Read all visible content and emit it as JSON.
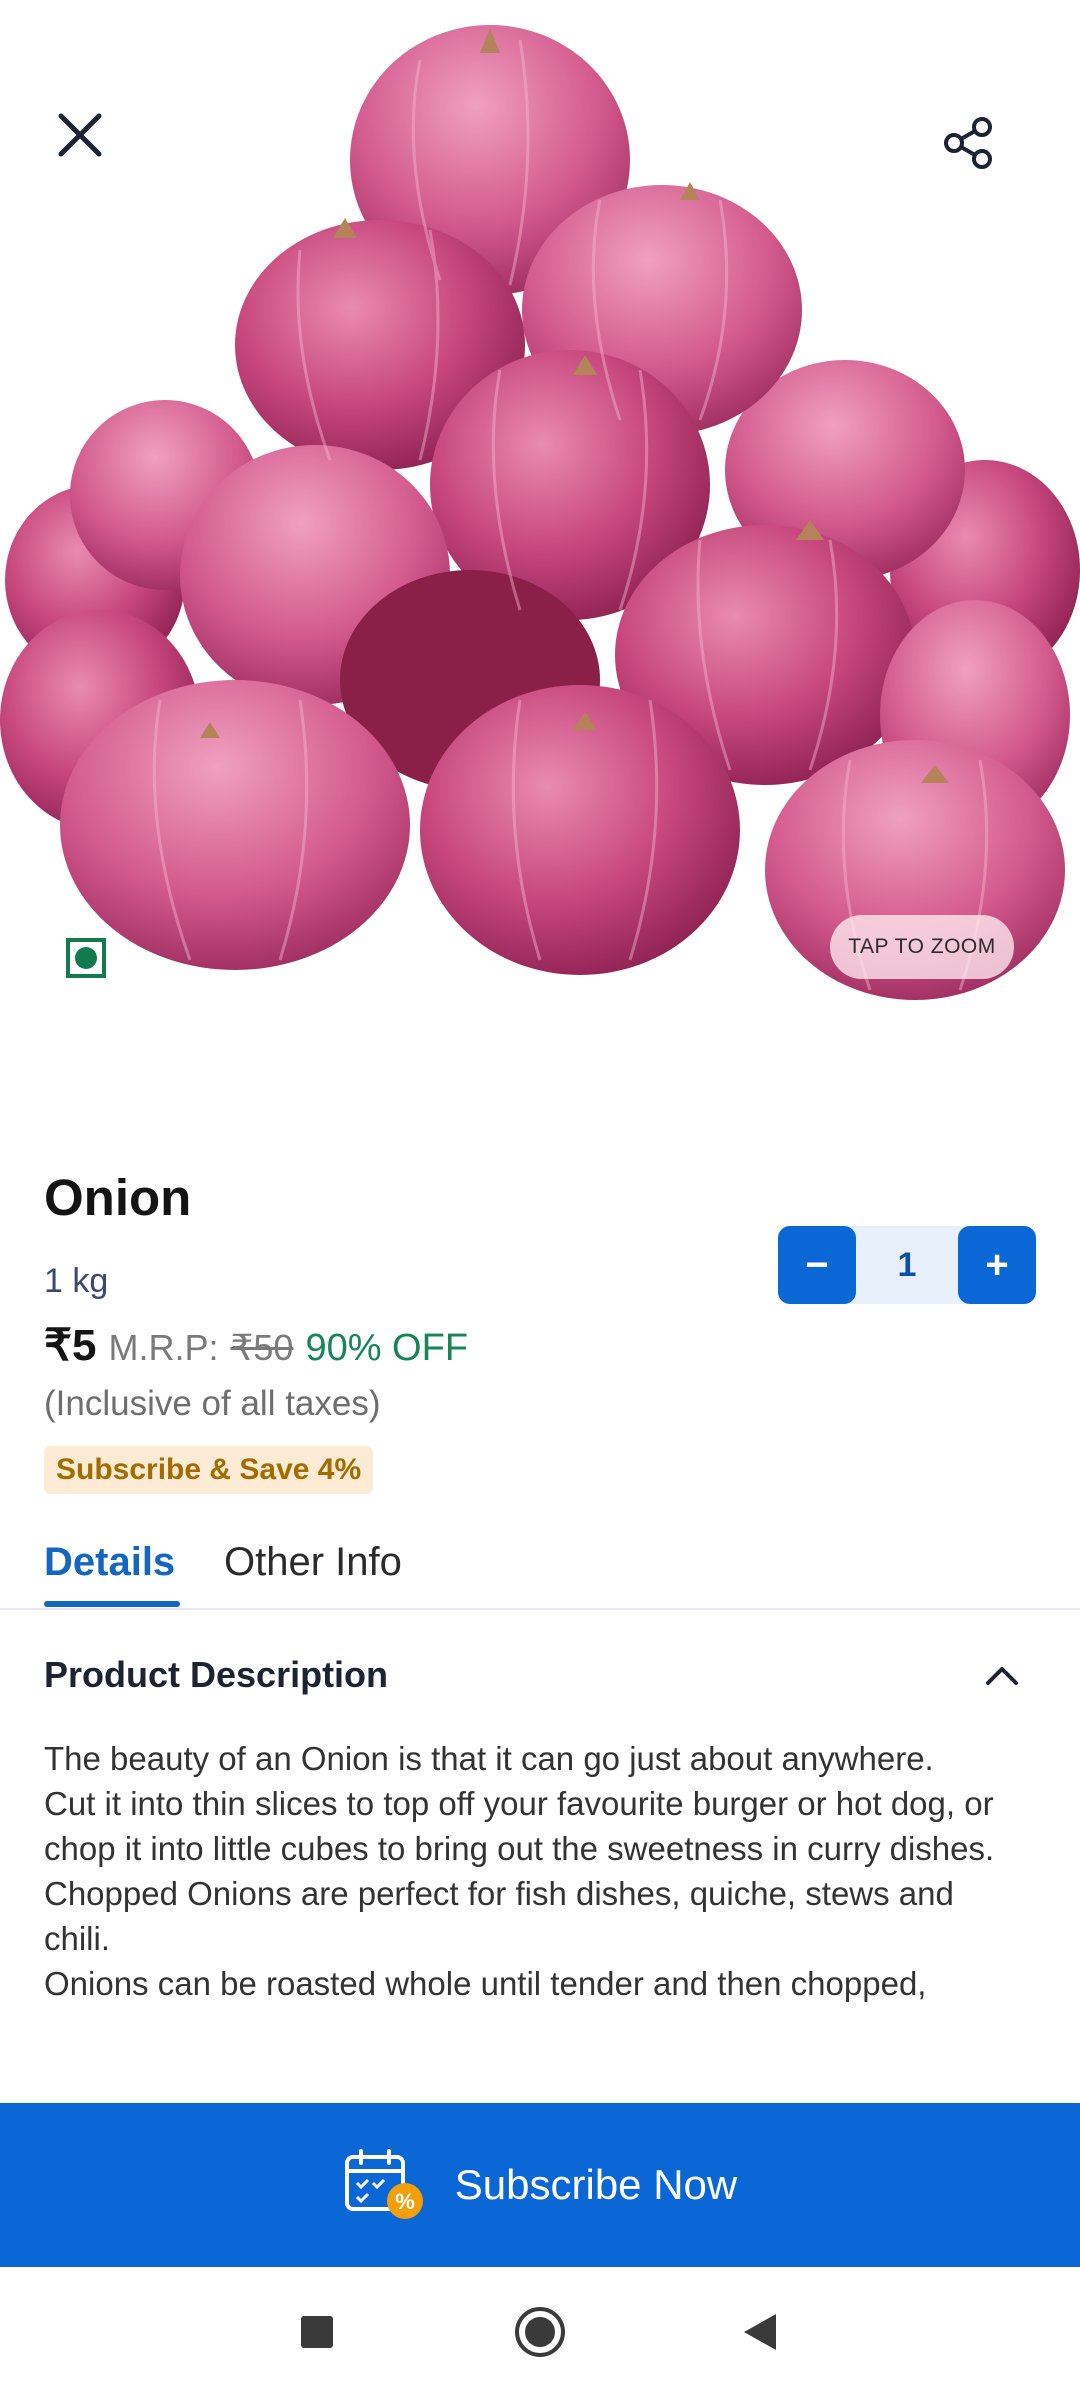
{
  "header": {
    "close_icon": "close-icon",
    "share_icon": "share-icon"
  },
  "hero": {
    "image_name": "onion-pile-image",
    "veg_mark": "veg-indicator",
    "zoom_label": "TAP TO ZOOM"
  },
  "product": {
    "name": "Onion",
    "weight": "1 kg",
    "price": "₹5",
    "mrp_label": "M.R.P:",
    "mrp_value": "₹50",
    "discount": "90% OFF",
    "tax_note": "(Inclusive of all taxes)",
    "subscribe_badge": "Subscribe & Save 4%"
  },
  "quantity": {
    "minus_label": "−",
    "value": "1",
    "plus_label": "+"
  },
  "tabs": [
    {
      "label": "Details",
      "active": true
    },
    {
      "label": "Other Info",
      "active": false
    }
  ],
  "description": {
    "heading": "Product Description",
    "paragraphs": [
      "The beauty of an Onion is that it can go just about anywhere.",
      "Cut it into thin slices to top off your favourite burger or hot dog, or chop it into little cubes to bring out the sweetness in curry dishes.",
      "Chopped Onions are perfect for fish dishes, quiche, stews and chili.",
      "Onions can be roasted whole until tender and then chopped,"
    ]
  },
  "subscribe_bar": {
    "label": "Subscribe Now",
    "icon": "calendar-discount-icon"
  },
  "colors": {
    "primary": "#0b66d6",
    "discount_green": "#18845a",
    "badge_bg": "#fdebd5",
    "badge_text": "#a46c00",
    "onion": "#c8487e"
  },
  "navbar": {
    "icons": [
      "recent-apps-icon",
      "home-icon",
      "back-icon"
    ]
  }
}
